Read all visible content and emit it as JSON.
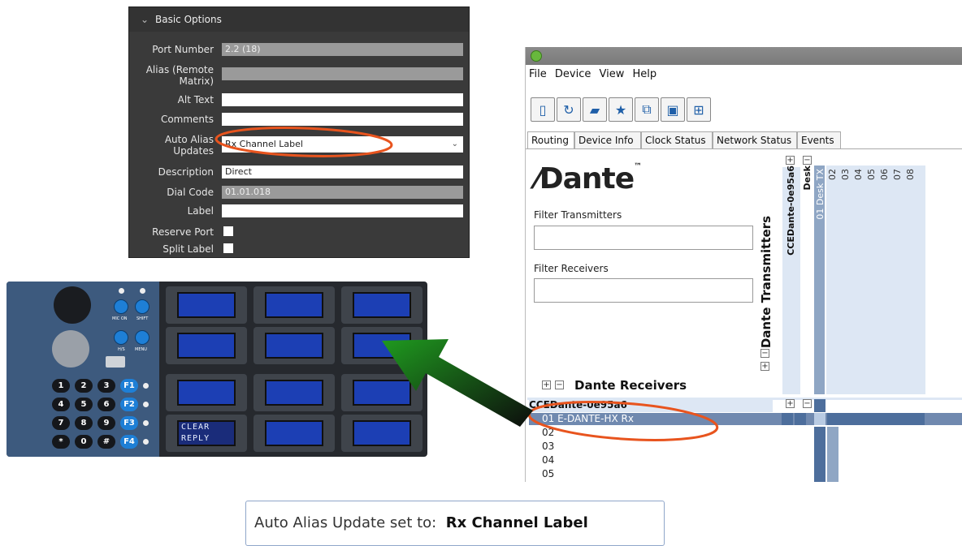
{
  "basic_options": {
    "section_title": "Basic Options",
    "fields": [
      {
        "label": "Port Number",
        "value": "2.2 (18)",
        "readonly": true
      },
      {
        "label": "Alias (Remote Matrix)",
        "value": "",
        "readonly": true
      },
      {
        "label": "Alt Text",
        "value": ""
      },
      {
        "label": "Comments",
        "value": ""
      },
      {
        "label": "Auto Alias Updates",
        "value": "Rx Channel Label"
      },
      {
        "label": "Description",
        "value": "Direct"
      },
      {
        "label": "Dial Code",
        "value": "01.01.018",
        "readonly": true
      },
      {
        "label": "Label",
        "value": ""
      }
    ],
    "checkboxes": [
      {
        "label": "Reserve Port",
        "checked": false
      },
      {
        "label": "Split Label",
        "checked": false
      }
    ]
  },
  "dante": {
    "menu": [
      "File",
      "Device",
      "View",
      "Help"
    ],
    "toolbar_icons": [
      "panel-icon",
      "refresh-icon",
      "folder-icon",
      "star-icon",
      "network-icon",
      "monitor-icon",
      "add-icon"
    ],
    "tabs": [
      "Routing",
      "Device Info",
      "Clock Status",
      "Network Status",
      "Events"
    ],
    "active_tab": "Routing",
    "logo": "Dante",
    "filter_transmitters_label": "Filter Transmitters",
    "filter_receivers_label": "Filter Receivers",
    "dante_transmitters_label": "Dante Transmitters",
    "dante_receivers_label": "Dante Receivers",
    "transmitter_device": "CCEDante-0e95a6",
    "desk_label": "Desk",
    "desk_channel": "01 Desk TX",
    "channel_numbers": [
      "02",
      "03",
      "04",
      "05",
      "06",
      "07",
      "08"
    ],
    "receiver_device": "CCEDante-0e95a6",
    "receiver_rows": [
      "01 E-DANTE-HX Rx",
      "02",
      "03",
      "04",
      "05"
    ]
  },
  "hardware": {
    "lcd_lines": [
      "CLEAR",
      "REPLY"
    ],
    "keypad": [
      "1",
      "2",
      "3",
      "F1",
      "4",
      "5",
      "6",
      "F2",
      "7",
      "8",
      "9",
      "F3",
      "*",
      "0",
      "#",
      "F4"
    ],
    "button_labels": [
      "MIC ON",
      "SHIFT",
      "H/S",
      "MENU"
    ]
  },
  "caption": {
    "prefix": "Auto Alias Update set to:",
    "value": "Rx Channel Label"
  },
  "colors": {
    "annotation": "#e8541e",
    "arrow": "#1a7a1a",
    "dante_blue": "#4d6e9c"
  }
}
